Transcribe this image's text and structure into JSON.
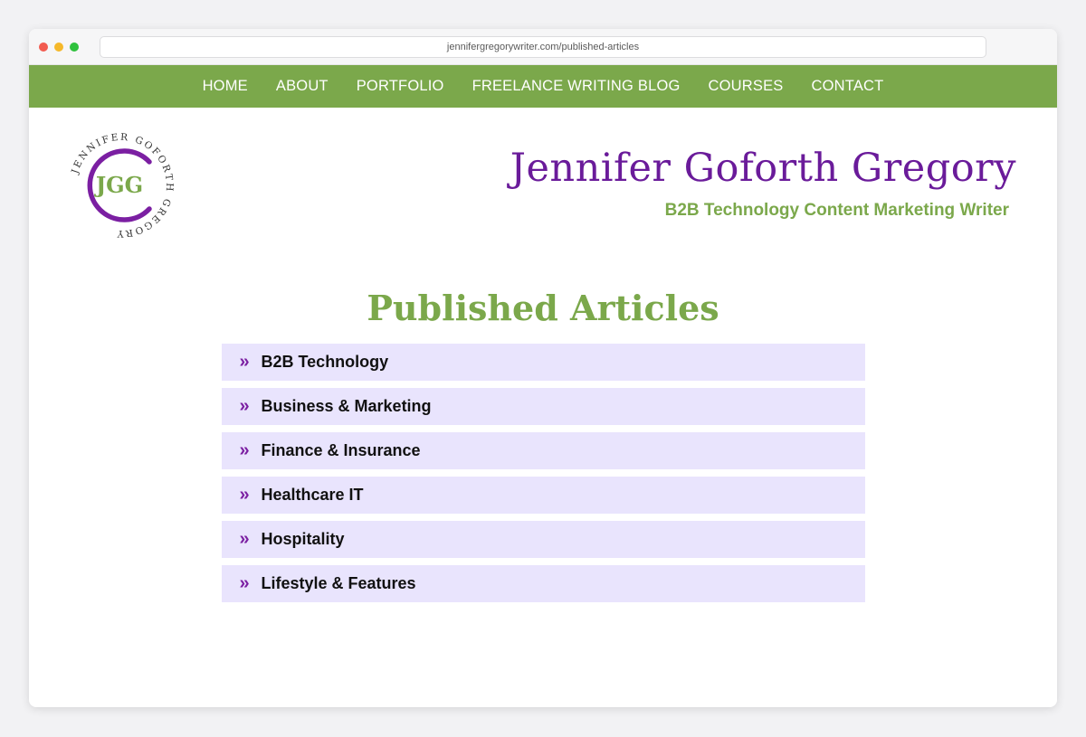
{
  "browser": {
    "url": "jennifergregorywriter.com/published-articles"
  },
  "nav": {
    "items": [
      {
        "label": "HOME"
      },
      {
        "label": "ABOUT"
      },
      {
        "label": "PORTFOLIO"
      },
      {
        "label": "FREELANCE WRITING BLOG"
      },
      {
        "label": "COURSES"
      },
      {
        "label": "CONTACT"
      }
    ]
  },
  "header": {
    "logo": {
      "initials": "JGG",
      "ring_text": "JENNIFER GOFORTH GREGORY"
    },
    "title": "Jennifer Goforth Gregory",
    "tagline": "B2B Technology Content Marketing Writer"
  },
  "main": {
    "heading": "Published Articles",
    "categories": [
      {
        "label": "B2B Technology",
        "icon": "double-chevron-right-icon"
      },
      {
        "label": "Business & Marketing",
        "icon": "double-chevron-right-icon"
      },
      {
        "label": "Finance & Insurance",
        "icon": "double-chevron-right-icon"
      },
      {
        "label": "Healthcare IT",
        "icon": "double-chevron-right-icon"
      },
      {
        "label": "Hospitality",
        "icon": "double-chevron-right-icon"
      },
      {
        "label": "Lifestyle & Features",
        "icon": "double-chevron-right-icon"
      }
    ]
  },
  "colors": {
    "nav_green": "#7ba84b",
    "title_purple": "#6a1b9a",
    "accordion_bg": "#e9e4fd",
    "chevron_purple": "#7b1fa2"
  }
}
